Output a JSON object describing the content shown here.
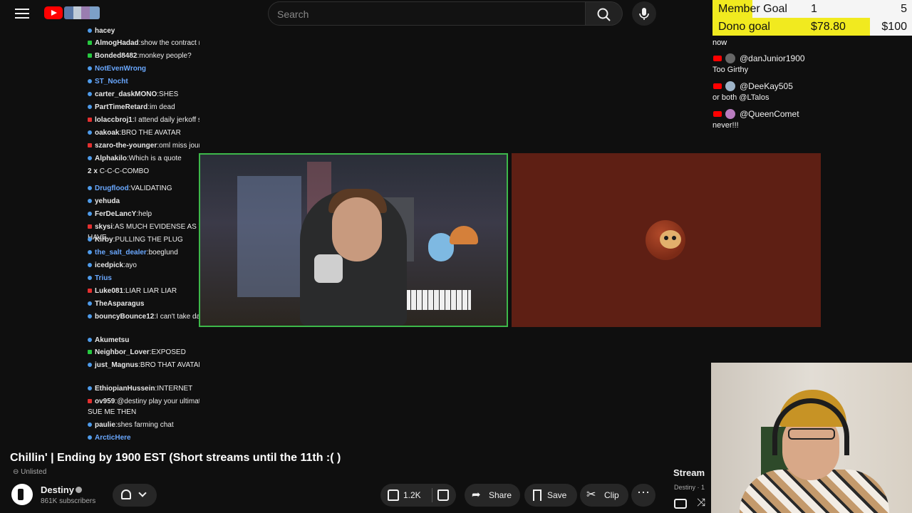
{
  "header": {
    "search_placeholder": "Search"
  },
  "goals": {
    "member": {
      "label": "Member Goal",
      "current": "1",
      "target": "5",
      "progress": 0.2
    },
    "dono": {
      "label": "Dono goal",
      "current": "$78.80",
      "target": "$100",
      "progress": 0.788
    }
  },
  "right_chat": {
    "tail": "now",
    "items": [
      {
        "handle": "@danJunior1900",
        "message": "Too Girthy",
        "avatar_letter": "D"
      },
      {
        "handle": "@DeeKay505",
        "message": "or both @LTalos"
      },
      {
        "handle": "@QueenComet",
        "message": "never!!!"
      }
    ]
  },
  "chat": [
    {
      "user": "hacey",
      "msg": "",
      "badge": "blue"
    },
    {
      "user": "AlmogHadad",
      "msg": "show the contract ma'am",
      "badge": "green"
    },
    {
      "user": "Bonded8482",
      "msg": "monkey people?",
      "badge": "green"
    },
    {
      "user": "NotEvenWrong",
      "msg": "",
      "badge": "blue",
      "blue": true
    },
    {
      "user": "ST_Nocht",
      "msg": "",
      "badge": "blue",
      "blue": true
    },
    {
      "user": "carter_daskMONO",
      "msg": "SHES",
      "badge": "blue"
    },
    {
      "user": "PartTimeRetard",
      "msg": "im dead",
      "badge": "blue"
    },
    {
      "user": "lolaccbroj1",
      "msg": "I attend daily jerkoff sessions",
      "badge": "red"
    },
    {
      "user": "oakoak",
      "msg": "BRO THE AVATAR",
      "badge": "blue"
    },
    {
      "user": "szaro-the-younger",
      "msg": "oml miss journalist",
      "badge": "red"
    },
    {
      "user": "Alphakilo",
      "msg": "Which is a quote",
      "badge": "blue"
    },
    {
      "user": "2 x",
      "msg": "C-C-C-COMBO",
      "badge": "none"
    },
    {
      "user": "Drugflood",
      "msg": "VALIDATING",
      "badge": "blue",
      "blue": true
    },
    {
      "user": "yehuda",
      "msg": "",
      "badge": "blue"
    },
    {
      "user": "FerDeLancY",
      "msg": "help",
      "badge": "blue"
    },
    {
      "user": "skysi",
      "msg": "AS MUCH EVIDENSE AS YOU HAVE",
      "badge": "red"
    },
    {
      "user": "Kirby",
      "msg": "PULLING THE PLUG",
      "badge": "blue"
    },
    {
      "user": "the_salt_dealer",
      "msg": "boeglund",
      "badge": "blue",
      "blue": true
    },
    {
      "user": "icedpick",
      "msg": "ayo",
      "badge": "blue"
    },
    {
      "user": "Trius",
      "msg": "",
      "badge": "blue",
      "blue": true
    },
    {
      "user": "Luke081",
      "msg": "LIAR LIAR LIAR",
      "badge": "red"
    },
    {
      "user": "TheAsparagus",
      "msg": "",
      "badge": "blue"
    },
    {
      "user": "bouncyBounce12",
      "msg": "I can't take dark money",
      "badge": "blue"
    },
    {
      "user": "Akumetsu",
      "msg": "",
      "badge": "blue"
    },
    {
      "user": "Neighbor_Lover",
      "msg": "EXPOSED",
      "badge": "green"
    },
    {
      "user": "just_Magnus",
      "msg": "BRO THAT AVATAR HOLY ****",
      "badge": "blue"
    },
    {
      "user": "EthiopianHussein",
      "msg": "INTERNET",
      "badge": "blue"
    },
    {
      "user": "ov959",
      "msg": "@destiny play your ultimate card! SUE ME THEN",
      "badge": "red"
    },
    {
      "user": "paulie",
      "msg": "shes farming chat",
      "badge": "blue"
    },
    {
      "user": "ArcticHere",
      "msg": "",
      "badge": "blue",
      "blue": true
    }
  ],
  "video": {
    "title": "Chillin' | Ending by 1900 EST (Short streams until the 11th :( )",
    "visibility": "Unlisted",
    "channel": "Destiny",
    "subscribers": "861K subscribers",
    "likes": "1.2K",
    "share_label": "Share",
    "save_label": "Save",
    "clip_label": "Clip"
  },
  "sidebar_preview": {
    "title": "Stream",
    "sub": "Destiny · 1"
  },
  "colors": {
    "accent": "#ff0000",
    "goal_fill": "#f1ea1f",
    "webcam_border": "#3db84a",
    "brown_panel": "#5e1f14"
  }
}
